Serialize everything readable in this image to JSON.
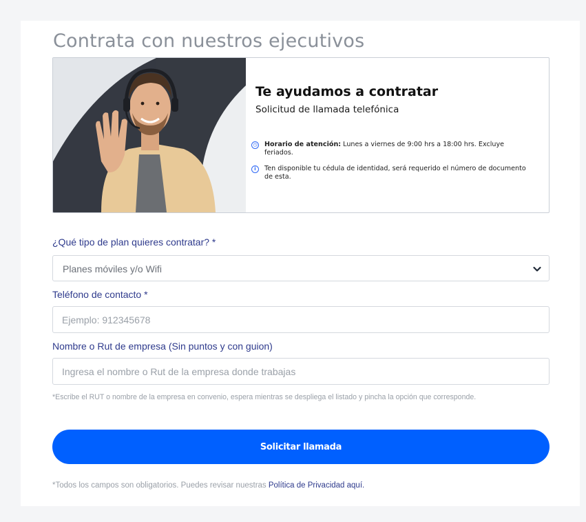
{
  "page": {
    "title": "Contrata con nuestros ejecutivos"
  },
  "banner": {
    "title": "Te ayudamos a contratar",
    "subtitle": "Solicitud de llamada telefónica",
    "info_items": [
      {
        "icon": "clock-icon",
        "bold": "Horario de atención:",
        "text": " Lunes a viernes de 9:00 hrs a 18:00 hrs. Excluye feriados."
      },
      {
        "icon": "info-icon",
        "bold": "",
        "text": "Ten disponible tu cédula de identidad, será requerido el número de documento de esta."
      }
    ],
    "image_alt": "agent-with-headset-photo"
  },
  "form": {
    "plan_label": "¿Qué tipo de plan quieres contratar? *",
    "plan_selected": "Planes móviles y/o Wifi",
    "phone_label": "Teléfono de contacto *",
    "phone_placeholder": "Ejemplo: 912345678",
    "company_label": "Nombre o Rut de empresa (Sin puntos y con guion)",
    "company_placeholder": "Ingresa el nombre o Rut de la empresa donde trabajas",
    "company_hint": "*Escribe el RUT o nombre de la empresa en convenio, espera mientras se despliega el listado y pincha la opción que corresponde.",
    "submit_label": "Solicitar llamada"
  },
  "footer": {
    "text": "*Todos los campos son obligatorios. Puedes revisar nuestras ",
    "link_label": "Política de Privacidad aquí."
  },
  "colors": {
    "accent": "#0060ff",
    "label": "#2e3a8c",
    "muted": "#9aa0a8"
  }
}
